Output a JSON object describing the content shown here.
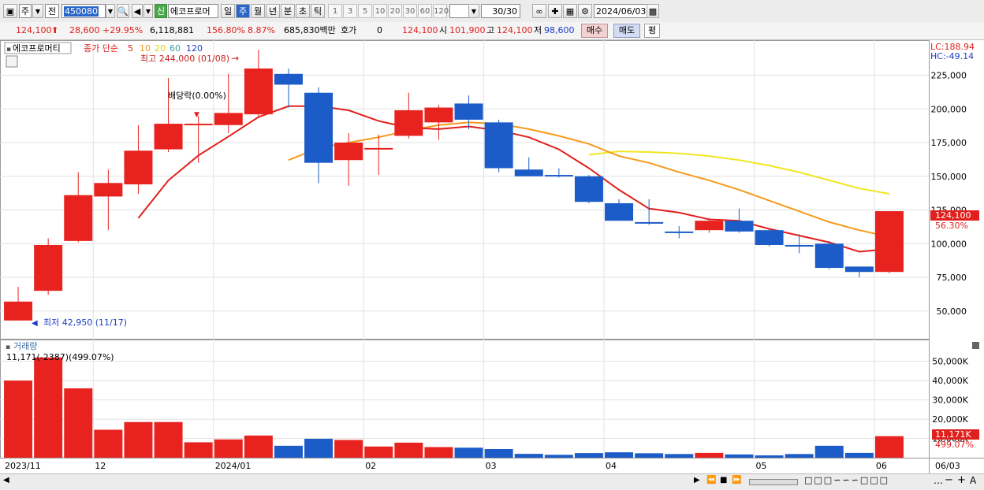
{
  "toolbar": {
    "type_label": "주",
    "prefix_label": "전",
    "code_value": "450080",
    "stock_badge": "신",
    "stock_name": "에코프로머",
    "period_tabs": [
      "일",
      "주",
      "월",
      "년",
      "분",
      "초",
      "틱"
    ],
    "active_period": "주",
    "intervals": [
      "1",
      "3",
      "5",
      "10",
      "20",
      "30",
      "60",
      "120"
    ],
    "count_value": "30/30",
    "date_value": "2024/06/03"
  },
  "quote": {
    "price": "124,100",
    "change": "28,600",
    "change_pct": "+29.95%",
    "volume": "6,118,881",
    "volume_ratio": "156.80%",
    "turnover": "8.87%",
    "amount": "685,830백만",
    "hoga_label": "호가",
    "hoga_value": "0",
    "hoga_price": "124,100",
    "open_label": "시",
    "open": "101,900",
    "high_label": "고",
    "high": "124,100",
    "low_label": "저",
    "low": "98,600",
    "buy_label": "매수",
    "sell_label": "매도",
    "eval_label": "평"
  },
  "legend": {
    "name": "에코프로머티",
    "ma_label": "종가 단순",
    "ma_periods": [
      "5",
      "10",
      "20",
      "60",
      "120"
    ],
    "ma_colors": [
      "#e0201c",
      "#f59a1a",
      "#f0e020",
      "#3aa0a0",
      "#1a3cc8"
    ]
  },
  "annotations": {
    "high": "최고 244,000 (01/08)",
    "low": "최저 42,950 (11/17)",
    "dividend": "배당락(0.00%)",
    "lc": "LC:188.94",
    "hc": "HC:-49.14",
    "last_price": "124,100",
    "last_pct": "56.30%",
    "volume_title": "거래량",
    "volume_info": "11,171(-2387)(499.07%)",
    "volume_last": "11,171K",
    "volume_last_pct": "499.07%"
  },
  "axis": {
    "price_ticks": [
      "225,000",
      "200,000",
      "175,000",
      "150,000",
      "125,000",
      "100,000",
      "75,000",
      "50,000"
    ],
    "volume_ticks": [
      "50,000K",
      "40,000K",
      "30,000K",
      "20,000K",
      "10,000K"
    ],
    "date_labels": [
      "2023/11",
      "12",
      "2024/01",
      "02",
      "03",
      "04",
      "05",
      "06"
    ],
    "date_right": "06/03"
  },
  "chart_data": {
    "type": "candlestick",
    "interval": "weekly",
    "candles": [
      {
        "o": 42950,
        "h": 68000,
        "l": 42950,
        "c": 57000
      },
      {
        "o": 65000,
        "h": 104000,
        "l": 62000,
        "c": 99000
      },
      {
        "o": 102000,
        "h": 153000,
        "l": 101000,
        "c": 136000
      },
      {
        "o": 135000,
        "h": 155000,
        "l": 110000,
        "c": 145000
      },
      {
        "o": 144000,
        "h": 188000,
        "l": 137000,
        "c": 169000
      },
      {
        "o": 170000,
        "h": 223000,
        "l": 168000,
        "c": 189000
      },
      {
        "o": 189000,
        "h": 195000,
        "l": 160000,
        "c": 189000
      },
      {
        "o": 188000,
        "h": 226000,
        "l": 182000,
        "c": 197000
      },
      {
        "o": 196000,
        "h": 244000,
        "l": 194000,
        "c": 230000
      },
      {
        "o": 226000,
        "h": 230000,
        "l": 201000,
        "c": 218000
      },
      {
        "o": 212000,
        "h": 216000,
        "l": 145000,
        "c": 160000
      },
      {
        "o": 162000,
        "h": 182000,
        "l": 143000,
        "c": 175000
      },
      {
        "o": 171000,
        "h": 181000,
        "l": 151000,
        "c": 171000
      },
      {
        "o": 180000,
        "h": 212000,
        "l": 178000,
        "c": 199000
      },
      {
        "o": 190000,
        "h": 203000,
        "l": 177000,
        "c": 201000
      },
      {
        "o": 204000,
        "h": 210000,
        "l": 185000,
        "c": 192000
      },
      {
        "o": 190000,
        "h": 192000,
        "l": 153000,
        "c": 156000
      },
      {
        "o": 155000,
        "h": 164000,
        "l": 150000,
        "c": 150000
      },
      {
        "o": 151000,
        "h": 156000,
        "l": 149000,
        "c": 150000
      },
      {
        "o": 150000,
        "h": 151000,
        "l": 130000,
        "c": 131000
      },
      {
        "o": 130000,
        "h": 133000,
        "l": 117000,
        "c": 117000
      },
      {
        "o": 116000,
        "h": 133000,
        "l": 114000,
        "c": 115000
      },
      {
        "o": 109000,
        "h": 113000,
        "l": 104000,
        "c": 108000
      },
      {
        "o": 110000,
        "h": 119000,
        "l": 108000,
        "c": 117000
      },
      {
        "o": 117000,
        "h": 126000,
        "l": 108000,
        "c": 109000
      },
      {
        "o": 110000,
        "h": 111000,
        "l": 98000,
        "c": 99000
      },
      {
        "o": 99000,
        "h": 107000,
        "l": 93000,
        "c": 98000
      },
      {
        "o": 100000,
        "h": 102000,
        "l": 81000,
        "c": 82000
      },
      {
        "o": 83000,
        "h": 83000,
        "l": 75000,
        "c": 79000
      },
      {
        "o": 79000,
        "h": 124100,
        "l": 78000,
        "c": 124100
      }
    ],
    "volume_k": [
      40000,
      52000,
      36000,
      14500,
      18500,
      18500,
      8000,
      9500,
      11500,
      6200,
      9800,
      9200,
      5800,
      7800,
      5500,
      5200,
      4500,
      2000,
      1500,
      2400,
      2800,
      2300,
      1900,
      2500,
      1700,
      1200,
      1900,
      6200,
      2500,
      11171
    ],
    "ma5": [
      null,
      null,
      null,
      null,
      119000,
      147000,
      165500,
      179500,
      194000,
      202000,
      202000,
      199000,
      191000,
      186000,
      185000,
      187000,
      184000,
      179000,
      170000,
      156000,
      140000,
      126000,
      123000,
      118000,
      117000,
      111000,
      106000,
      101000,
      94000,
      96000
    ],
    "ma10": [
      null,
      null,
      null,
      null,
      null,
      null,
      null,
      null,
      null,
      162000,
      171000,
      175000,
      179000,
      184000,
      188000,
      190000,
      189000,
      185000,
      180000,
      174000,
      165000,
      160000,
      153000,
      147000,
      140000,
      132000,
      124000,
      116000,
      110000,
      105000
    ],
    "ma20": [
      null,
      null,
      null,
      null,
      null,
      null,
      null,
      null,
      null,
      null,
      null,
      null,
      null,
      null,
      null,
      null,
      null,
      null,
      null,
      166000,
      168500,
      168000,
      167000,
      165000,
      162000,
      158000,
      153000,
      147000,
      141000,
      137000
    ],
    "ylim": [
      30000,
      244000
    ]
  }
}
